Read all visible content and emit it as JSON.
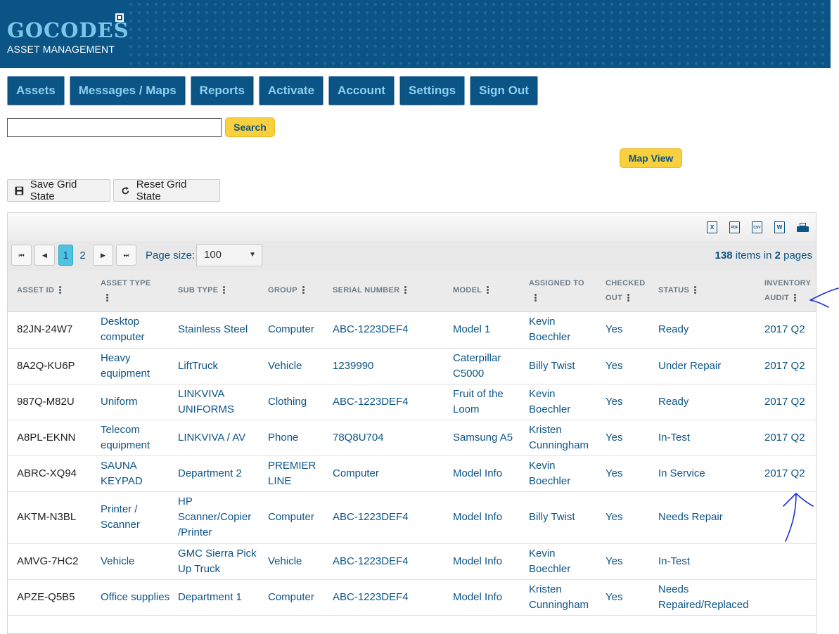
{
  "brand": {
    "logo": "GOCODES",
    "subtitle": "ASSET MANAGEMENT"
  },
  "nav": [
    "Assets",
    "Messages / Maps",
    "Reports",
    "Activate",
    "Account",
    "Settings",
    "Sign Out"
  ],
  "search": {
    "value": "",
    "button": "Search"
  },
  "map_view": "Map View",
  "grid_state": {
    "save": "Save Grid State",
    "reset": "Reset Grid State"
  },
  "exports": [
    "X",
    "PDF",
    "CSV",
    "W",
    "print"
  ],
  "pager": {
    "pages": [
      "1",
      "2"
    ],
    "current": "1",
    "page_size_label": "Page size:",
    "page_size": "100",
    "total_items": "138",
    "items_in": "items in",
    "total_pages": "2",
    "pages_word": "pages"
  },
  "columns": [
    [
      "ASSET ID"
    ],
    [
      "ASSET TYPE"
    ],
    [
      "SUB TYPE"
    ],
    [
      "GROUP"
    ],
    [
      "SERIAL NUMBER"
    ],
    [
      "MODEL"
    ],
    [
      "ASSIGNED TO"
    ],
    [
      "CHECKED",
      "OUT"
    ],
    [
      "STATUS"
    ],
    [
      "INVENTORY",
      "AUDIT"
    ]
  ],
  "rows": [
    [
      "82JN-24W7",
      "Desktop computer",
      "Stainless Steel",
      "Computer",
      "ABC-1223DEF4",
      "Model 1",
      "Kevin Boechler",
      "Yes",
      "Ready",
      "2017 Q2"
    ],
    [
      "8A2Q-KU6P",
      "Heavy equipment",
      "LiftTruck",
      "Vehicle",
      "1239990",
      "Caterpillar C5000",
      "Billy Twist",
      "Yes",
      "Under Repair",
      "2017 Q2"
    ],
    [
      "987Q-M82U",
      "Uniform",
      "LINKVIVA UNIFORMS",
      "Clothing",
      "ABC-1223DEF4",
      "Fruit of the Loom",
      "Kevin Boechler",
      "Yes",
      "Ready",
      "2017 Q2"
    ],
    [
      "A8PL-EKNN",
      "Telecom equipment",
      "LINKVIVA / AV",
      "Phone",
      "78Q8U704",
      "Samsung A5",
      "Kristen Cunningham",
      "Yes",
      "In-Test",
      "2017 Q2"
    ],
    [
      "ABRC-XQ94",
      "SAUNA KEYPAD",
      "Department 2",
      "PREMIER LINE",
      "Computer",
      "Model Info",
      "Kevin Boechler",
      "Yes",
      "In Service",
      "2017 Q2"
    ],
    [
      "AKTM-N3BL",
      "Printer / Scanner",
      "HP Scanner/Copier /Printer",
      "Computer",
      "ABC-1223DEF4",
      "Model Info",
      "Billy Twist",
      "Yes",
      "Needs Repair",
      ""
    ],
    [
      "AMVG-7HC2",
      "Vehicle",
      "GMC Sierra Pick Up Truck",
      "Vehicle",
      "ABC-1223DEF4",
      "Model Info",
      "Kevin Boechler",
      "Yes",
      "In-Test",
      ""
    ],
    [
      "APZE-Q5B5",
      "Office supplies",
      "Department 1",
      "Computer",
      "ABC-1223DEF4",
      "Model Info",
      "Kristen Cunningham",
      "Yes",
      "Needs Repaired/Replaced",
      ""
    ]
  ]
}
